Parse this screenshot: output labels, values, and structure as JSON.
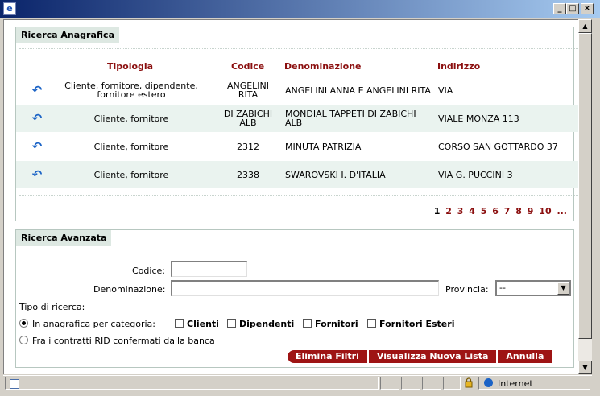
{
  "window": {
    "buttons": {
      "minimize": "_",
      "maximize": "□",
      "close": "×"
    }
  },
  "ricerca_anagrafica": {
    "title": "Ricerca Anagrafica",
    "columns": [
      "Tipologia",
      "Codice",
      "Denominazione",
      "Indirizzo"
    ],
    "rows": [
      {
        "tipologia": "Cliente, fornitore, dipendente, fornitore estero",
        "codice": "ANGELINI RITA",
        "denominazione": "ANGELINI ANNA E ANGELINI RITA",
        "indirizzo": "VIA"
      },
      {
        "tipologia": "Cliente, fornitore",
        "codice": "DI ZABICHI ALB",
        "denominazione": "MONDIAL TAPPETI DI ZABICHI ALB",
        "indirizzo": "VIALE MONZA 113"
      },
      {
        "tipologia": "Cliente, fornitore",
        "codice": "2312",
        "denominazione": "MINUTA PATRIZIA",
        "indirizzo": "CORSO SAN GOTTARDO 37"
      },
      {
        "tipologia": "Cliente, fornitore",
        "codice": "2338",
        "denominazione": "SWAROVSKI I. D'ITALIA",
        "indirizzo": "VIA G. PUCCINI 3"
      }
    ],
    "select_icon": "return-arrow-icon",
    "pager": {
      "current": "1",
      "pages": [
        "2",
        "3",
        "4",
        "5",
        "6",
        "7",
        "8",
        "9",
        "10"
      ],
      "more": "..."
    }
  },
  "ricerca_avanzata": {
    "title": "Ricerca Avanzata",
    "codice_label": "Codice:",
    "codice_value": "",
    "denominazione_label": "Denominazione:",
    "denominazione_value": "",
    "provincia_label": "Provincia:",
    "provincia_value": "--",
    "tipo_label": "Tipo di ricerca:",
    "radio_categoria": "In anagrafica per categoria:",
    "radio_rid": "Fra i contratti RID confermati dalla banca",
    "categorie": [
      "Clienti",
      "Dipendenti",
      "Fornitori",
      "Fornitori Esteri"
    ],
    "buttons": {
      "elimina": "Elimina Filtri",
      "visualizza": "Visualizza Nuova Lista",
      "annulla": "Annulla"
    }
  },
  "statusbar": {
    "zone": "Internet"
  },
  "colors": {
    "accent_red": "#9e1414",
    "header_text": "#8b0f0f",
    "panel_title_bg": "#dde8e2",
    "row_alt": "#eaf3ef"
  }
}
